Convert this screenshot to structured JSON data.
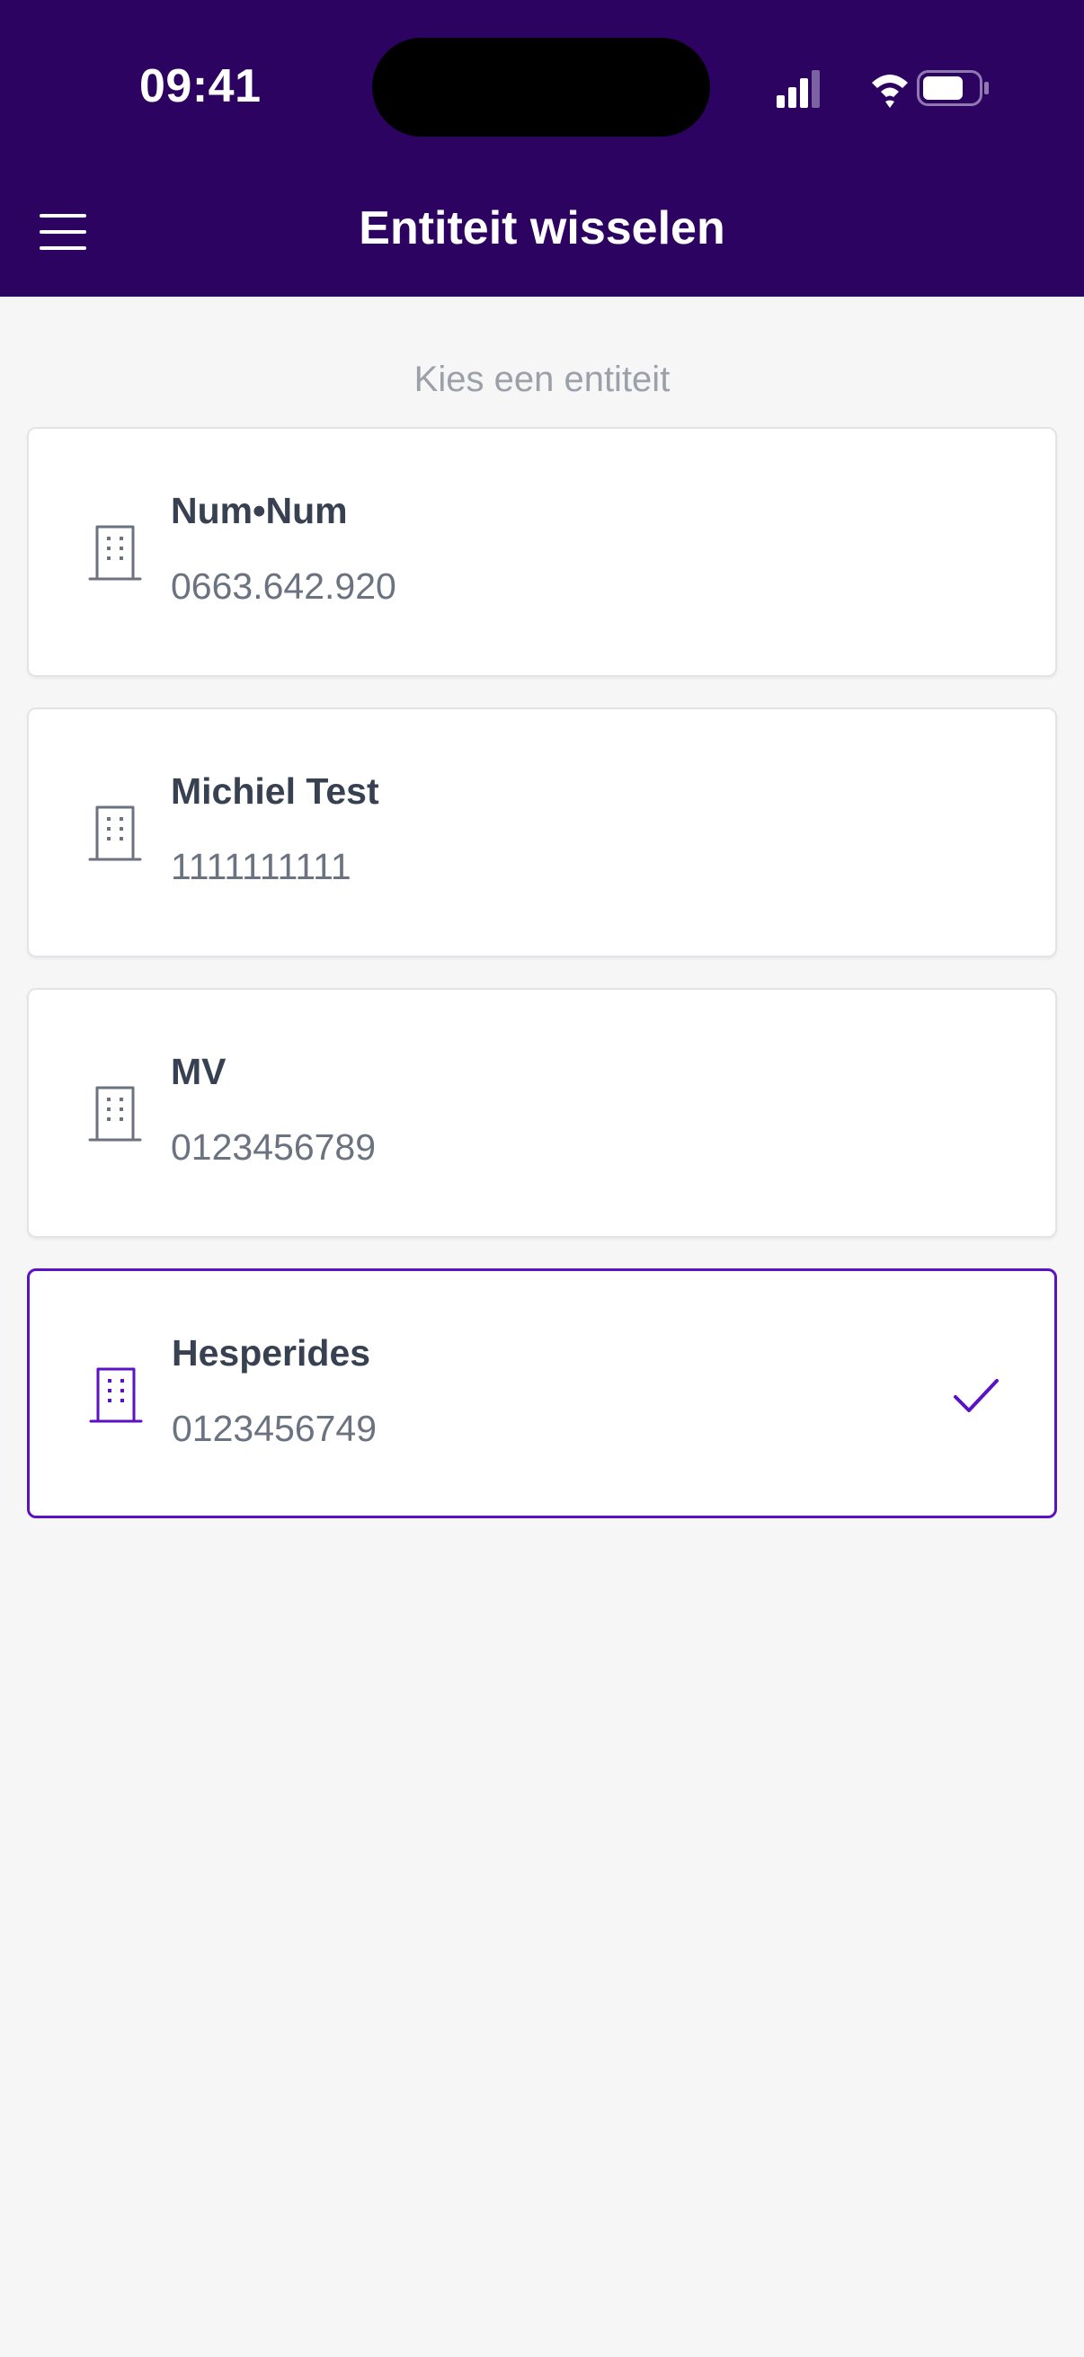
{
  "status_bar": {
    "time": "09:41"
  },
  "header": {
    "title": "Entiteit wisselen",
    "background_color": "#2d0362"
  },
  "subtitle": "Kies een entiteit",
  "accent_color": "#5b12c4",
  "entities": [
    {
      "name": "Num•Num",
      "number": "0663.642.920",
      "selected": false
    },
    {
      "name": "Michiel Test",
      "number": "1111111111",
      "selected": false
    },
    {
      "name": "MV",
      "number": "0123456789",
      "selected": false
    },
    {
      "name": "Hesperides",
      "number": "0123456749",
      "selected": true
    }
  ],
  "icons": {
    "menu": "hamburger-menu-icon",
    "entity": "building-icon",
    "selected": "checkmark-icon"
  }
}
